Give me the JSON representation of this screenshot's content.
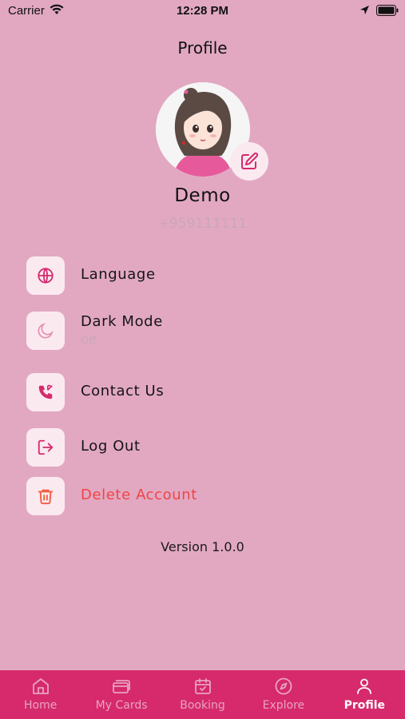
{
  "status_bar": {
    "carrier": "Carrier",
    "time": "12:28 PM"
  },
  "header": {
    "title": "Profile"
  },
  "profile": {
    "name": "Demo",
    "phone": "+959111111"
  },
  "menu": {
    "language": {
      "label": "Language",
      "icon": "globe-icon"
    },
    "dark_mode": {
      "label": "Dark Mode",
      "value": "Off",
      "icon": "moon-icon"
    },
    "contact_us": {
      "label": "Contact Us",
      "icon": "phone-icon"
    },
    "log_out": {
      "label": "Log Out",
      "icon": "logout-icon"
    },
    "delete_account": {
      "label": "Delete Account",
      "icon": "trash-icon",
      "color": "#ef4444"
    }
  },
  "version": "Version 1.0.0",
  "tabs": [
    {
      "label": "Home",
      "icon": "home-icon",
      "active": false
    },
    {
      "label": "My Cards",
      "icon": "cards-icon",
      "active": false
    },
    {
      "label": "Booking",
      "icon": "calendar-icon",
      "active": false
    },
    {
      "label": "Explore",
      "icon": "compass-icon",
      "active": false
    },
    {
      "label": "Profile",
      "icon": "user-icon",
      "active": true
    }
  ],
  "colors": {
    "background": "#e2a8c2",
    "accent": "#d62a6c",
    "icon_bg": "#fbe9f0",
    "danger": "#ef4444"
  }
}
